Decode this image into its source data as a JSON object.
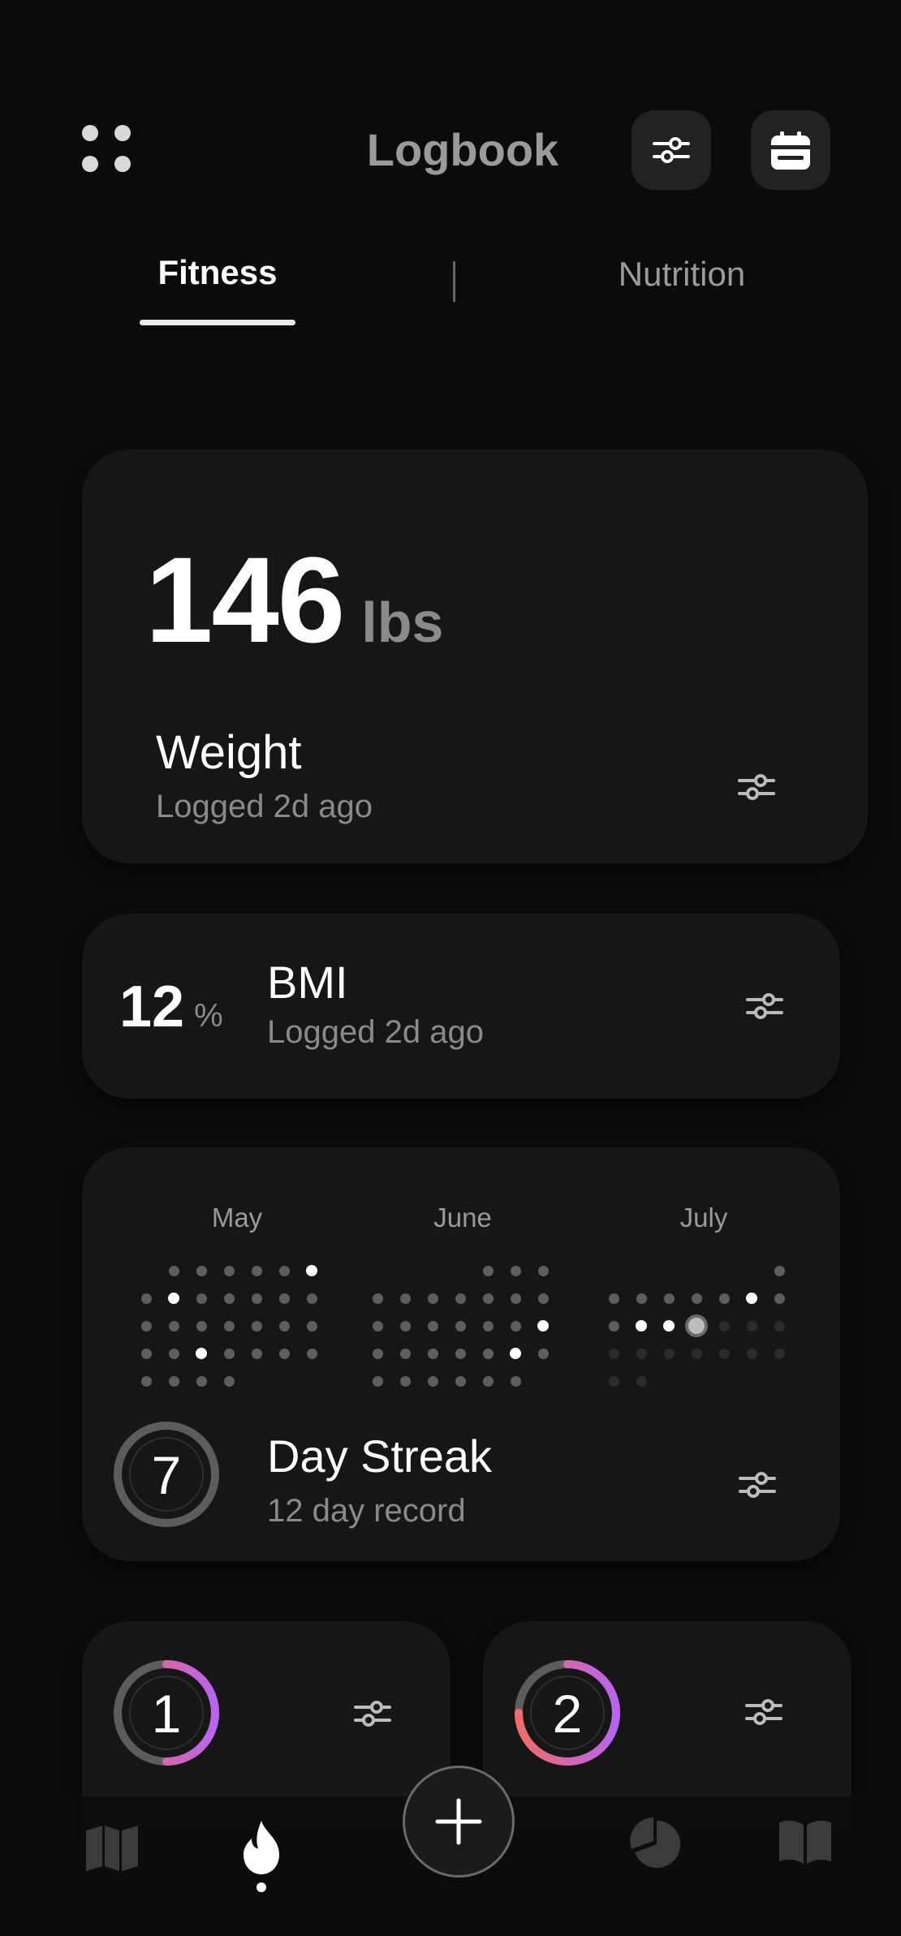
{
  "header": {
    "title": "Logbook",
    "menu_icon": "grid-dots-icon",
    "filter_icon": "sliders-icon",
    "calendar_icon": "calendar-icon"
  },
  "tabs": [
    {
      "label": "Fitness",
      "active": true
    },
    {
      "label": "Nutrition",
      "active": false
    }
  ],
  "weight_card": {
    "value": "146",
    "unit": "lbs",
    "title": "Weight",
    "subtitle": "Logged 2d ago"
  },
  "bmi_card": {
    "value": "12",
    "unit": "%",
    "title": "BMI",
    "subtitle": "Logged 2d ago"
  },
  "streak_card": {
    "months": [
      "May",
      "June",
      "July"
    ],
    "value": "7",
    "title": "Day Streak",
    "subtitle": "12 day record"
  },
  "mini_cards": [
    {
      "value": "1",
      "progress": 0.5
    },
    {
      "value": "2",
      "progress": 0.75
    }
  ],
  "bottom_nav": {
    "items": [
      "map-icon",
      "flame-icon",
      "add-icon",
      "pie-chart-icon",
      "book-icon"
    ],
    "active": "flame-icon"
  },
  "colors": {
    "background": "#0b0b0b",
    "card": "#161616",
    "accent_start": "#ef6b6b",
    "accent_end": "#b964f0"
  }
}
